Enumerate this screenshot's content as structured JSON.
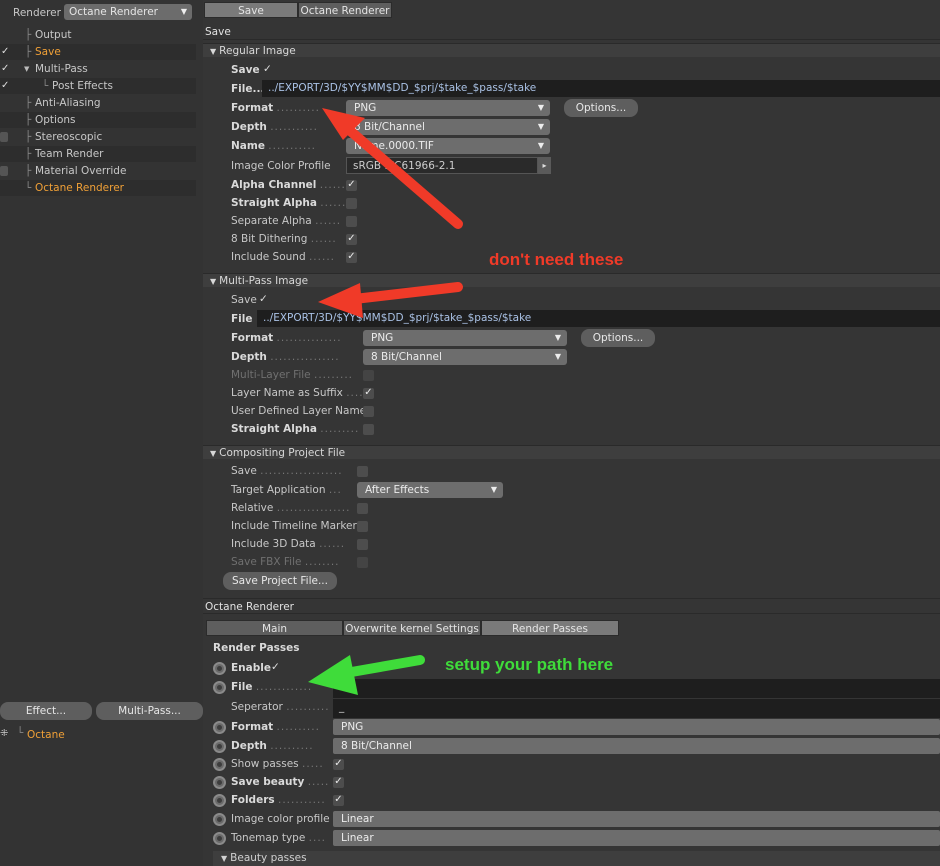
{
  "left": {
    "renderer_label": "Renderer",
    "renderer_value": "Octane Renderer",
    "tree": [
      {
        "label": "Output",
        "check": "none"
      },
      {
        "label": "Save",
        "check": "tick",
        "active": true
      },
      {
        "label": "Multi-Pass",
        "check": "tick"
      },
      {
        "label": "Post Effects",
        "check": "tick"
      },
      {
        "label": "Anti-Aliasing",
        "check": "none"
      },
      {
        "label": "Options",
        "check": "none"
      },
      {
        "label": "Stereoscopic",
        "check": "box"
      },
      {
        "label": "Team Render",
        "check": "none"
      },
      {
        "label": "Material Override",
        "check": "box"
      },
      {
        "label": "Octane Renderer",
        "check": "none",
        "active": true
      }
    ],
    "effect_button": "Effect...",
    "multipass_button": "Multi-Pass...",
    "octane_item": "Octane"
  },
  "top_tabs": [
    "Save",
    "Octane Renderer"
  ],
  "save_header": "Save",
  "regular_image": {
    "title": "Regular Image",
    "save_label": "Save",
    "file_label": "File...",
    "file_value": "../EXPORT/3D/$YY$MM$DD_$prj/$take_$pass/$take",
    "format_label": "Format",
    "format_value": "PNG",
    "options_button": "Options...",
    "depth_label": "Depth",
    "depth_value": "8 Bit/Channel",
    "name_label": "Name",
    "name_value": "Name.0000.TIF",
    "profile_label": "Image Color Profile",
    "profile_value": "sRGB IEC61966-2.1",
    "alpha_label": "Alpha Channel",
    "straight_label": "Straight Alpha",
    "separate_label": "Separate Alpha",
    "dither_label": "8 Bit Dithering",
    "sound_label": "Include Sound"
  },
  "multipass_image": {
    "title": "Multi-Pass Image",
    "save_label": "Save",
    "file_label": "File",
    "file_value": "../EXPORT/3D/$YY$MM$DD_$prj/$take_$pass/$take",
    "format_label": "Format",
    "format_value": "PNG",
    "options_button": "Options...",
    "depth_label": "Depth",
    "depth_value": "8 Bit/Channel",
    "multilayer_label": "Multi-Layer File",
    "suffix_label": "Layer Name as Suffix",
    "userdef_label": "User Defined Layer Name",
    "straight_label": "Straight Alpha"
  },
  "compositing": {
    "title": "Compositing Project File",
    "save_label": "Save",
    "target_label": "Target Application",
    "target_value": "After Effects",
    "relative_label": "Relative",
    "timeline_label": "Include Timeline Marker",
    "data3d_label": "Include 3D Data",
    "fbx_label": "Save FBX File",
    "save_project_button": "Save Project File..."
  },
  "octane": {
    "header": "Octane Renderer",
    "tabs": [
      "Main",
      "Overwrite kernel Settings",
      "Render Passes"
    ],
    "section": "Render Passes",
    "enable_label": "Enable",
    "file_label": "File",
    "separator_label": "Seperator",
    "separator_value": "_",
    "format_label": "Format",
    "format_value": "PNG",
    "depth_label": "Depth",
    "depth_value": "8 Bit/Channel",
    "show_passes_label": "Show passes",
    "save_beauty_label": "Save beauty",
    "folders_label": "Folders",
    "img_profile_label": "Image color profile",
    "img_profile_value": "Linear",
    "tonemap_label": "Tonemap type",
    "tonemap_value": "Linear",
    "beauty_passes": "Beauty passes"
  },
  "annotations": {
    "dont_need": "don't need these",
    "setup_path": "setup your path here"
  },
  "colors": {
    "orange_text": "#f0a037",
    "red_annotation": "#f03a28",
    "green_annotation": "#3fdc3a"
  }
}
